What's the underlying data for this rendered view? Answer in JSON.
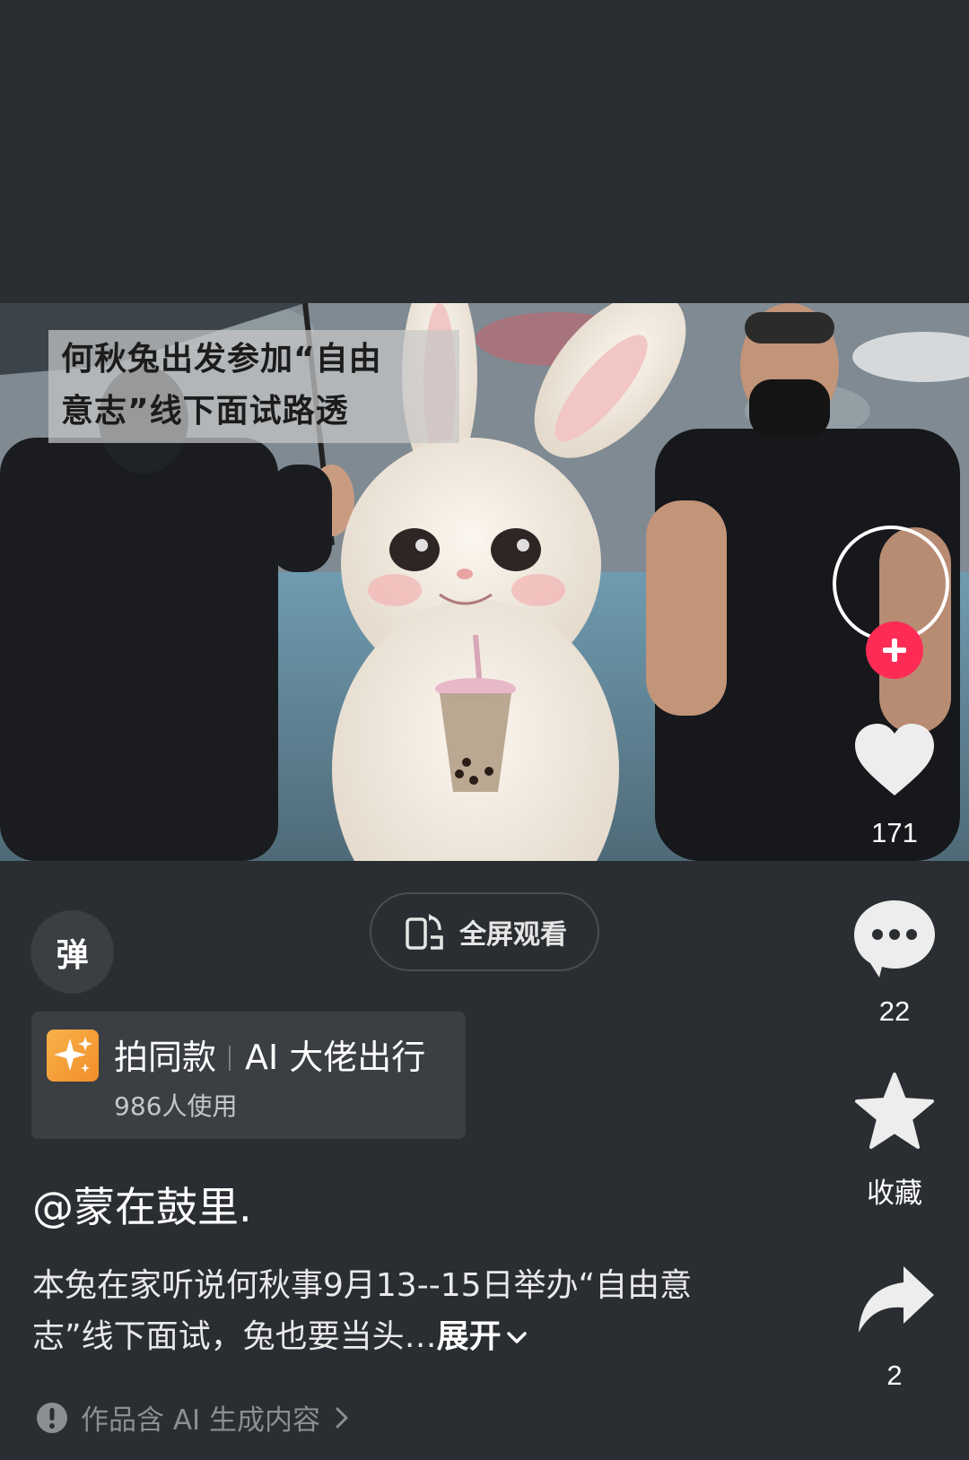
{
  "video": {
    "caption_line1": "何秋兔出发参加“自由",
    "caption_line2": "意志”线下面试路透"
  },
  "rail": {
    "like_count": "171",
    "comment_count": "22",
    "favorite_label": "收藏",
    "share_count": "2"
  },
  "controls": {
    "danmu_label": "弹",
    "fullscreen_label": "全屏观看"
  },
  "template": {
    "action": "拍同款",
    "name": "AI 大佬出行",
    "usage": "986人使用"
  },
  "author": "@蒙在鼓里.",
  "description": {
    "text": "本兔在家听说何秋事9月13--15日举办“自由意志”线下面试，兔也要当头…",
    "expand_label": "展开"
  },
  "ai_notice": "作品含 AI 生成内容",
  "colors": {
    "background": "#2a2d31",
    "follow_button": "#fe2c55",
    "template_icon": "#f8b34a"
  }
}
